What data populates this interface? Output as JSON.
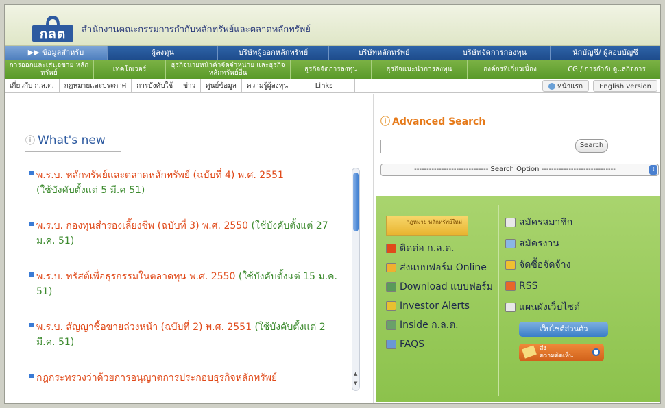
{
  "header": {
    "logo_text": "กลต",
    "site_title": "สำนักงานคณะกรรมการกำกับหลักทรัพย์และตลาดหลักทรัพย์"
  },
  "nav_primary": [
    {
      "label": "▶▶ ข้อมูลสำหรับ",
      "active": true
    },
    {
      "label": "ผู้ลงทุน",
      "active": false
    },
    {
      "label": "บริษัทผู้ออกหลักทรัพย์",
      "active": false
    },
    {
      "label": "บริษัทหลักทรัพย์",
      "active": false
    },
    {
      "label": "บริษัทจัดการกองทุน",
      "active": false
    },
    {
      "label": "นักบัญชี/ ผู้สอบบัญชี",
      "active": false
    }
  ],
  "nav_secondary": [
    {
      "label": "การออกและเสนอขาย หลักทรัพย์"
    },
    {
      "label": "เทคโอเวอร์"
    },
    {
      "label": "ธุรกิจนายหน้าค้าจัดจำหน่าย และธุรกิจหลักทรัพย์อื่น"
    },
    {
      "label": "ธุรกิจจัดการลงทุน"
    },
    {
      "label": "ธุรกิจแนะนำการลงทุน"
    },
    {
      "label": "องค์กรที่เกี่ยวเนื่อง"
    },
    {
      "label": "CG / การกำกับดูแลกิจการ"
    }
  ],
  "nav_tertiary": [
    {
      "label": "เกี่ยวกับ ก.ล.ต."
    },
    {
      "label": "กฎหมายและประกาศ"
    },
    {
      "label": "การบังคับใช้"
    },
    {
      "label": "ข่าว"
    },
    {
      "label": "ศูนย์ข้อมูล"
    },
    {
      "label": "ความรู้ผู้ลงทุน"
    },
    {
      "label": "Links"
    }
  ],
  "home_label": "หน้าแรก",
  "english_label": "English version",
  "whats_new": {
    "title": "What's new",
    "items": [
      {
        "title": "พ.ร.บ. หลักทรัพย์และตลาดหลักทรัพย์ (ฉบับที่ 4) พ.ศ. 2551",
        "date": "(ใช้บังคับตั้งแต่ 5 มี.ค 51)"
      },
      {
        "title": "พ.ร.บ. กองทุนสำรองเลี้ยงชีพ (ฉบับที่ 3) พ.ศ. 2550",
        "date": "(ใช้บังคับตั้งแต่ 27 ม.ค. 51)"
      },
      {
        "title": "พ.ร.บ. ทรัสต์เพื่อธุรกรรมในตลาดทุน พ.ศ. 2550",
        "date": "(ใช้บังคับตั้งแต่ 15 ม.ค. 51)"
      },
      {
        "title": "พ.ร.บ. สัญญาซื้อขายล่วงหน้า (ฉบับที่ 2) พ.ศ. 2551",
        "date": "(ใช้บังคับตั้งแต่ 2 มี.ค. 51)"
      },
      {
        "title": "กฎกระทรวงว่าด้วยการอนุญาตการประกอบธุรกิจหลักทรัพย์",
        "date": ""
      }
    ]
  },
  "search": {
    "title": "Advanced Search",
    "input_value": "",
    "button_label": "Search",
    "option_label": "------------------------------ Search Option ------------------------------"
  },
  "quick_links": {
    "law_banner": "กฎหมาย หลักทรัพย์ใหม่",
    "left": [
      "ติดต่อ ก.ล.ต.",
      "ส่งแบบฟอร์ม Online",
      "Download แบบฟอร์ม",
      "Investor Alerts",
      "Inside ก.ล.ต.",
      "FAQS"
    ],
    "right": [
      "สมัครสมาชิก",
      "สมัครงาน",
      "จัดซื้อจัดจ้าง",
      "RSS",
      "แผนผังเว็บไซต์"
    ],
    "private_site": "เว็บไซต์ส่วนตัว",
    "feedback_line1": "ส่ง",
    "feedback_line2": "ความคิดเห็น"
  },
  "colors": {
    "nav_blue": "#1e4c8c",
    "nav_green": "#5a9a2a",
    "news_title": "#e04a1a",
    "news_date": "#3c8a2e",
    "accent_orange": "#e67a1a"
  }
}
